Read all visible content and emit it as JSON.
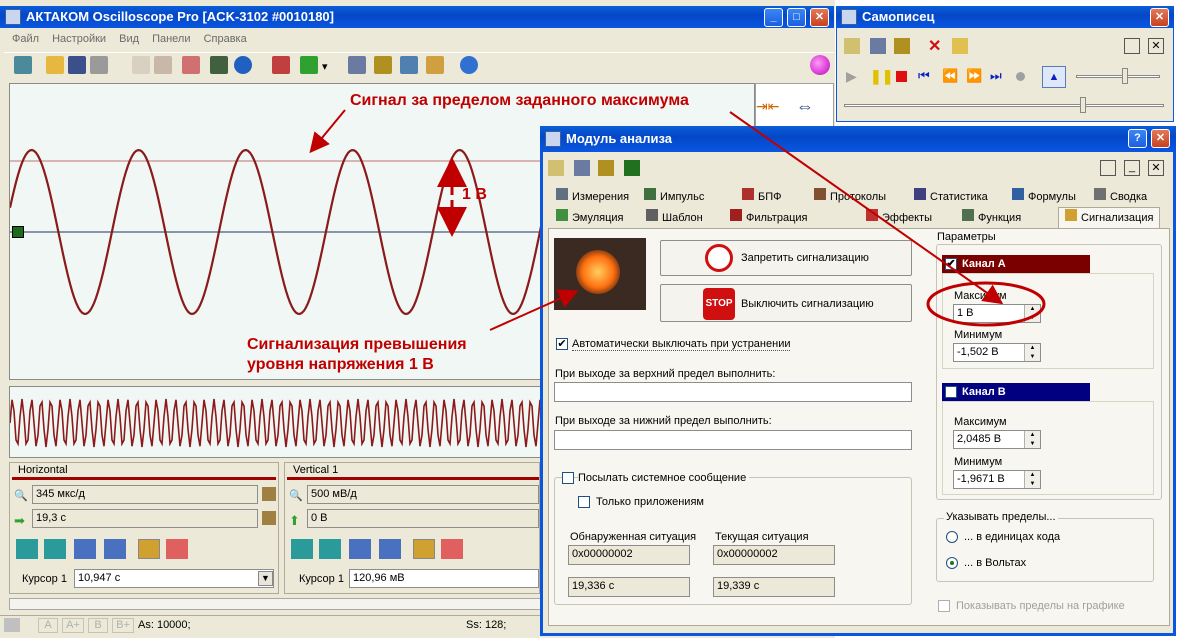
{
  "main_window": {
    "title": "АКТАКОМ Oscilloscope Pro [ACK-3102 #0010180]",
    "menu": [
      "Файл",
      "Настройки",
      "Вид",
      "Панели",
      "Справка"
    ]
  },
  "scope_annotations": {
    "range_label": "1 В",
    "top_note": "Сигнал за пределом заданного максимума",
    "bottom_note_line1": "Сигнализация превышения",
    "bottom_note_line2": "уровня напряжения 1 В"
  },
  "horizontal_panel": {
    "title": "Horizontal",
    "timebase": "345 мкс/д",
    "offset": "19,3 с",
    "cursor_label": "Курсор 1",
    "cursor_value": "10,947 с"
  },
  "vertical_panel": {
    "title": "Vertical 1",
    "scale": "500 мВ/д",
    "offset": "0 В",
    "cursor_label": "Курсор 1",
    "cursor_value": "120,96 мВ"
  },
  "status_bar": {
    "buttons": [
      "A",
      "A+",
      "B",
      "B+"
    ],
    "as": "As: 10000;",
    "ss": "Ss: 128;"
  },
  "recorder_window": {
    "title": "Самописец"
  },
  "analysis_window": {
    "title": "Модуль анализа",
    "tabs_row1": [
      "Измерения",
      "Импульс",
      "БПФ",
      "Протоколы",
      "Статистика",
      "Формулы",
      "Сводка"
    ],
    "tabs_row2": [
      "Эмуляция",
      "Шаблон",
      "Фильтрация",
      "Эффекты",
      "Функция",
      "Сигнализация"
    ],
    "active_tab": "Сигнализация",
    "btn_forbid": "Запретить сигнализацию",
    "btn_off": "Выключить сигнализацию",
    "stop_text": "STOP",
    "auto_off_label": "Автоматически выключать при устранении",
    "upper_label": "При выходе за верхний предел выполнить:",
    "lower_label": "При выходе за нижний предел выполнить:",
    "send_msg_label": "Посылать системное сообщение",
    "only_apps_label": "Только приложениям",
    "detected_label": "Обнаруженная ситуация",
    "current_label": "Текущая ситуация",
    "detected_code": "0x00000002",
    "current_code": "0x00000002",
    "detected_time": "19,336 с",
    "current_time": "19,339 с",
    "params_title": "Параметры",
    "channel_a": {
      "label": "Канал А",
      "max_label": "Максимум",
      "max": "1 В",
      "min_label": "Минимум",
      "min": "-1,502 В"
    },
    "channel_b": {
      "label": "Канал B",
      "max_label": "Максимум",
      "max": "2,0485 В",
      "min_label": "Минимум",
      "min": "-1,9671 В"
    },
    "limits_title": "Указывать пределы...",
    "limits_code": "... в единицах кода",
    "limits_volts": "... в Вольтах",
    "show_limits": "Показывать пределы на графике"
  },
  "colors": {
    "title_blue": "#0a56e0",
    "annotation_red": "#c00000",
    "channel_a": "#7a0000",
    "channel_b": "#000080",
    "signal": "#8b1a1a"
  }
}
